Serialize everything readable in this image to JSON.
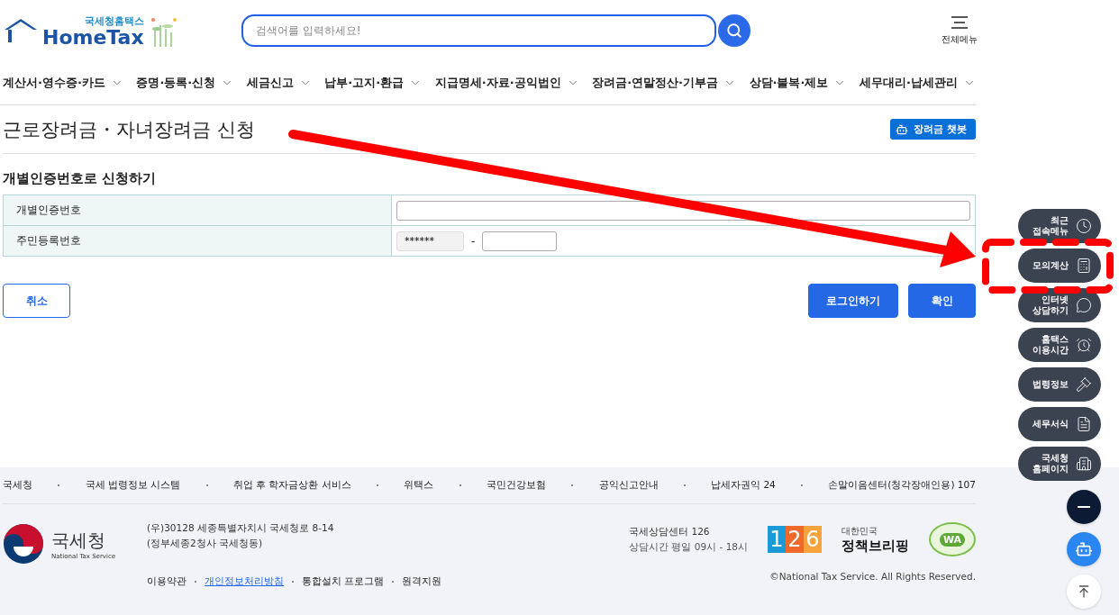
{
  "header": {
    "logo_caption": "국세청홈택스",
    "logo_name": "HomeTax",
    "search": {
      "placeholder": "검색어를 입력하세요!"
    },
    "menu_label": "전체메뉴"
  },
  "nav": [
    "계산서·영수증·카드",
    "증명·등록·신청",
    "세금신고",
    "납부·고지·환급",
    "지급명세·자료·공익법인",
    "장려금·연말정산·기부금",
    "상담·불복·제보",
    "세무대리·납세관리"
  ],
  "page": {
    "title": "근로장려금・자녀장려금 신청",
    "chatbot_button": "장려금 챗봇",
    "section_title": "개별인증번호로 신청하기",
    "form": [
      {
        "kind": "single",
        "label": "개별인증번호"
      },
      {
        "kind": "split",
        "label": "주민등록번호",
        "value": "******",
        "separator": "-"
      }
    ],
    "buttons": {
      "cancel": "취소",
      "login": "로그인하기",
      "confirm": "확인"
    }
  },
  "quick_menu": [
    {
      "label": "최근\n접속메뉴"
    },
    {
      "label": "모의계산"
    },
    {
      "label": "인터넷\n상담하기"
    },
    {
      "label": "홈택스\n이용시간"
    },
    {
      "label": "법령정보"
    },
    {
      "label": "세무서식"
    },
    {
      "label": "국세청\n홈페이지"
    }
  ],
  "footer": {
    "links": [
      "국세청",
      "국세 법령정보 시스템",
      "취업 후 학자금상환 서비스",
      "위택스",
      "국민건강보험",
      "공익신고안내",
      "납세자권익 24",
      "손말이음센터(청각장애인용) 107"
    ],
    "agency_name": "국세청",
    "agency_name_en": "National Tax Service",
    "address": [
      "(우)30128 세종특별자치시 국세청로 8-14",
      "(정부세종2청사 국세청동)"
    ],
    "policy_links": [
      {
        "label": "이용약관",
        "selected": false
      },
      {
        "label": "개인정보처리방침",
        "selected": true
      },
      {
        "label": "통합설치 프로그램",
        "selected": false
      },
      {
        "label": "원격지원",
        "selected": false
      }
    ],
    "call_center": "국세상담센터 126",
    "hours": "상담시간 평일 09시 - 18시",
    "badge_126": "126",
    "briefing_small": "대한민국",
    "briefing_name": "정책브리핑",
    "wa_mark": "WA",
    "copyright": "©National Tax Service. All Rights Reserved."
  }
}
